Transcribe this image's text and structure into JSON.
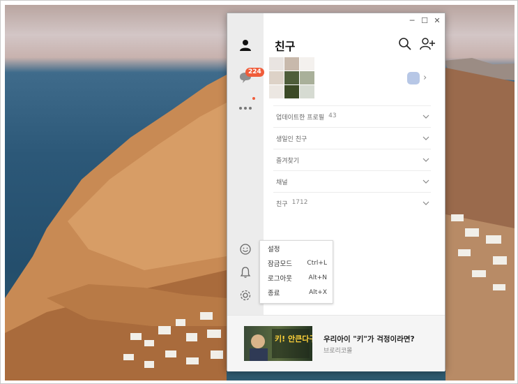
{
  "friends_panel": {
    "title": "친구",
    "sections": [
      {
        "label": "업데이트한 프로필",
        "count": "43"
      },
      {
        "label": "생일인 친구",
        "count": ""
      },
      {
        "label": "즐겨찾기",
        "count": ""
      },
      {
        "label": "채널",
        "count": ""
      },
      {
        "label": "친구",
        "count": "1712"
      }
    ]
  },
  "sidebar": {
    "chat_badge": "224"
  },
  "settings_menu": {
    "items": [
      {
        "label": "설정",
        "shortcut": ""
      },
      {
        "label": "잠금모드",
        "shortcut": "Ctrl+L"
      },
      {
        "label": "로그아웃",
        "shortcut": "Alt+N"
      },
      {
        "label": "종료",
        "shortcut": "Alt+X"
      }
    ]
  },
  "ad": {
    "title": "우리아이 \"키\"가 걱정이라면?",
    "source": "브로리코몰",
    "thumb_text": "키! 안큰다구요??"
  },
  "colors": {
    "badge": "#f05c3a",
    "sidebar_bg": "#ececec"
  }
}
